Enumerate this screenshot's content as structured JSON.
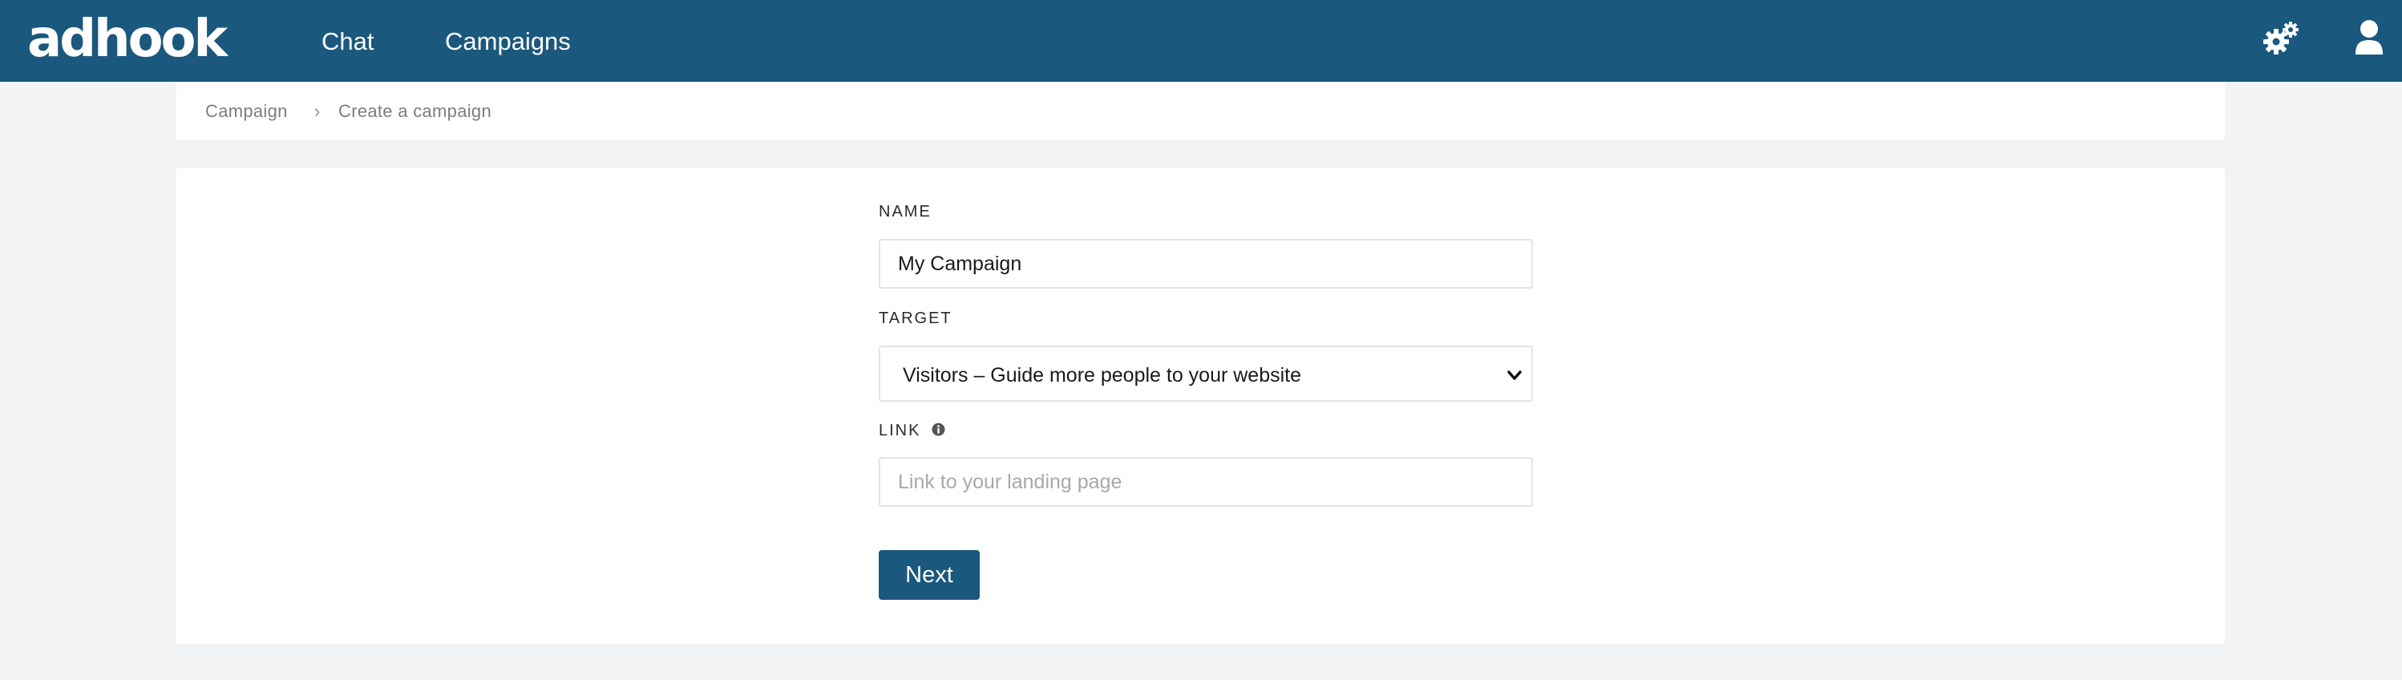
{
  "brand": {
    "logo_text": "adhook",
    "color": "#1b587d"
  },
  "nav": {
    "links": [
      {
        "label": "Chat"
      },
      {
        "label": "Campaigns"
      }
    ],
    "icons": [
      "gears-icon",
      "user-icon"
    ]
  },
  "breadcrumb": {
    "items": [
      "Campaign",
      "Create a campaign"
    ],
    "separator": "›"
  },
  "form": {
    "name": {
      "label": "NAME",
      "value": "My Campaign"
    },
    "target": {
      "label": "TARGET",
      "selected": "Visitors – Guide more people to your website"
    },
    "link": {
      "label": "LINK",
      "placeholder": "Link to your landing page",
      "value": ""
    },
    "next_label": "Next"
  }
}
